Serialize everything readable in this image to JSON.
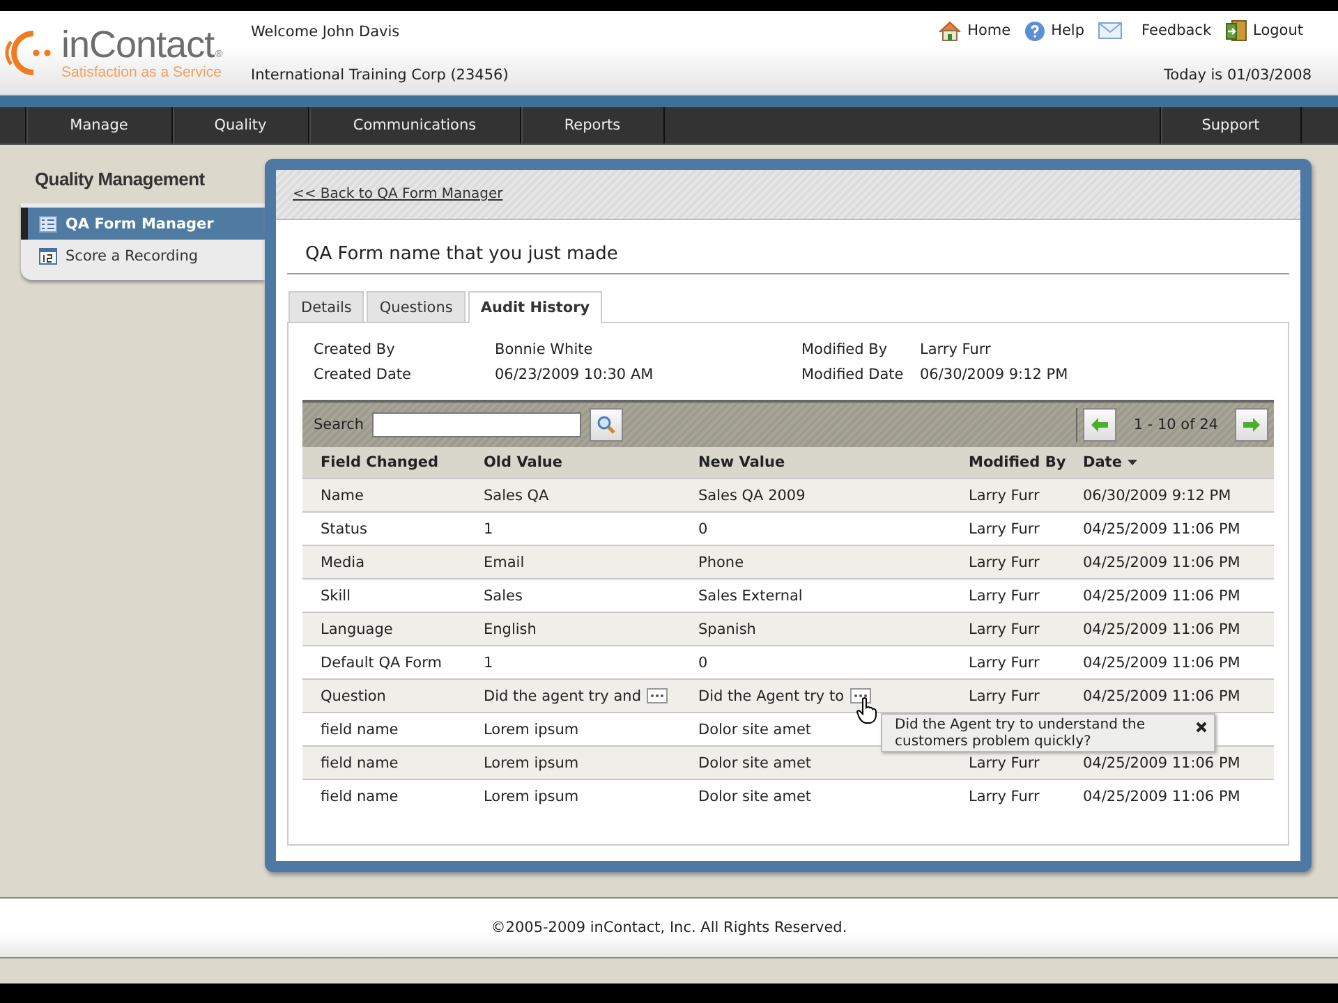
{
  "header": {
    "logo": {
      "name": "inContact",
      "mark": "®",
      "tagline": "Satisfaction as a Service"
    },
    "welcome": "Welcome John Davis",
    "account": "International Training Corp (23456)",
    "links": [
      {
        "kind": "home",
        "label": "Home"
      },
      {
        "kind": "help",
        "label": "Help"
      },
      {
        "kind": "mail",
        "label": "Feedback"
      },
      {
        "kind": "logout",
        "label": "Logout"
      }
    ],
    "today": "Today is 01/03/2008"
  },
  "nav": {
    "items": [
      "Manage",
      "Quality",
      "Communications",
      "Reports"
    ],
    "right_item": "Support"
  },
  "sidebar": {
    "title": "Quality Management",
    "items": [
      {
        "label": "QA Form Manager",
        "kind": "list",
        "selected": true
      },
      {
        "label": "Score a Recording",
        "kind": "calendar",
        "selected": false
      }
    ]
  },
  "main": {
    "back_link": "<< Back to QA Form Manager",
    "title": "QA Form name that you just made",
    "tabs": [
      {
        "label": "Details",
        "selected": false
      },
      {
        "label": "Questions",
        "selected": false
      },
      {
        "label": "Audit History",
        "selected": true
      }
    ],
    "meta": [
      {
        "label": "Created By",
        "value": "Bonnie White"
      },
      {
        "label": "Modified By",
        "value": "Larry Furr"
      },
      {
        "label": "Created Date",
        "value": "06/23/2009 10:30 AM"
      },
      {
        "label": "Modified Date",
        "value": "06/30/2009 9:12 PM"
      }
    ],
    "search": {
      "label": "Search"
    },
    "pagination": "1 - 10 of 24",
    "table": {
      "columns": [
        {
          "label": "Field Changed",
          "sorted": false
        },
        {
          "label": "Old Value",
          "sorted": false
        },
        {
          "label": "New Value",
          "sorted": false
        },
        {
          "label": "Modified By",
          "sorted": false
        },
        {
          "label": "Date",
          "sorted": true
        }
      ],
      "rows": [
        {
          "cells": [
            {
              "text": "Name",
              "more": false
            },
            {
              "text": "Sales QA",
              "more": false
            },
            {
              "text": "Sales QA 2009",
              "more": false
            },
            {
              "text": "Larry Furr",
              "more": false
            },
            {
              "text": "06/30/2009 9:12 PM",
              "more": false
            }
          ]
        },
        {
          "cells": [
            {
              "text": "Status",
              "more": false
            },
            {
              "text": "1",
              "more": false
            },
            {
              "text": "0",
              "more": false
            },
            {
              "text": "Larry Furr",
              "more": false
            },
            {
              "text": "04/25/2009 11:06 PM",
              "more": false
            }
          ]
        },
        {
          "cells": [
            {
              "text": "Media",
              "more": false
            },
            {
              "text": "Email",
              "more": false
            },
            {
              "text": "Phone",
              "more": false
            },
            {
              "text": "Larry Furr",
              "more": false
            },
            {
              "text": "04/25/2009 11:06 PM",
              "more": false
            }
          ]
        },
        {
          "cells": [
            {
              "text": "Skill",
              "more": false
            },
            {
              "text": "Sales",
              "more": false
            },
            {
              "text": "Sales External",
              "more": false
            },
            {
              "text": "Larry Furr",
              "more": false
            },
            {
              "text": "04/25/2009 11:06 PM",
              "more": false
            }
          ]
        },
        {
          "cells": [
            {
              "text": "Language",
              "more": false
            },
            {
              "text": "English",
              "more": false
            },
            {
              "text": "Spanish",
              "more": false
            },
            {
              "text": "Larry Furr",
              "more": false
            },
            {
              "text": "04/25/2009 11:06 PM",
              "more": false
            }
          ]
        },
        {
          "cells": [
            {
              "text": "Default QA Form",
              "more": false
            },
            {
              "text": "1",
              "more": false
            },
            {
              "text": "0",
              "more": false
            },
            {
              "text": "Larry Furr",
              "more": false
            },
            {
              "text": "04/25/2009 11:06 PM",
              "more": false
            }
          ]
        },
        {
          "cells": [
            {
              "text": "Question",
              "more": false
            },
            {
              "text": "Did the agent try and",
              "more": true
            },
            {
              "text": "Did the Agent try to",
              "more": true
            },
            {
              "text": "Larry Furr",
              "more": false
            },
            {
              "text": "04/25/2009 11:06 PM",
              "more": false
            }
          ]
        },
        {
          "cells": [
            {
              "text": "field name",
              "more": false
            },
            {
              "text": "Lorem ipsum",
              "more": false
            },
            {
              "text": "Dolor site amet",
              "more": false
            }
          ]
        },
        {
          "cells": [
            {
              "text": "field name",
              "more": false
            },
            {
              "text": "Lorem ipsum",
              "more": false
            },
            {
              "text": "Dolor site amet",
              "more": false
            },
            {
              "text": "Larry Furr",
              "more": false
            },
            {
              "text": "04/25/2009 11:06 PM",
              "more": false
            }
          ]
        },
        {
          "cells": [
            {
              "text": "field name",
              "more": false
            },
            {
              "text": "Lorem ipsum",
              "more": false
            },
            {
              "text": "Dolor site amet",
              "more": false
            },
            {
              "text": "Larry Furr",
              "more": false
            },
            {
              "text": "04/25/2009 11:06 PM",
              "more": false
            }
          ]
        }
      ]
    },
    "tooltip": {
      "text": "Did the Agent try to understand the customers problem quickly?"
    }
  },
  "footer": "©2005-2009 inContact, Inc. All Rights Reserved."
}
